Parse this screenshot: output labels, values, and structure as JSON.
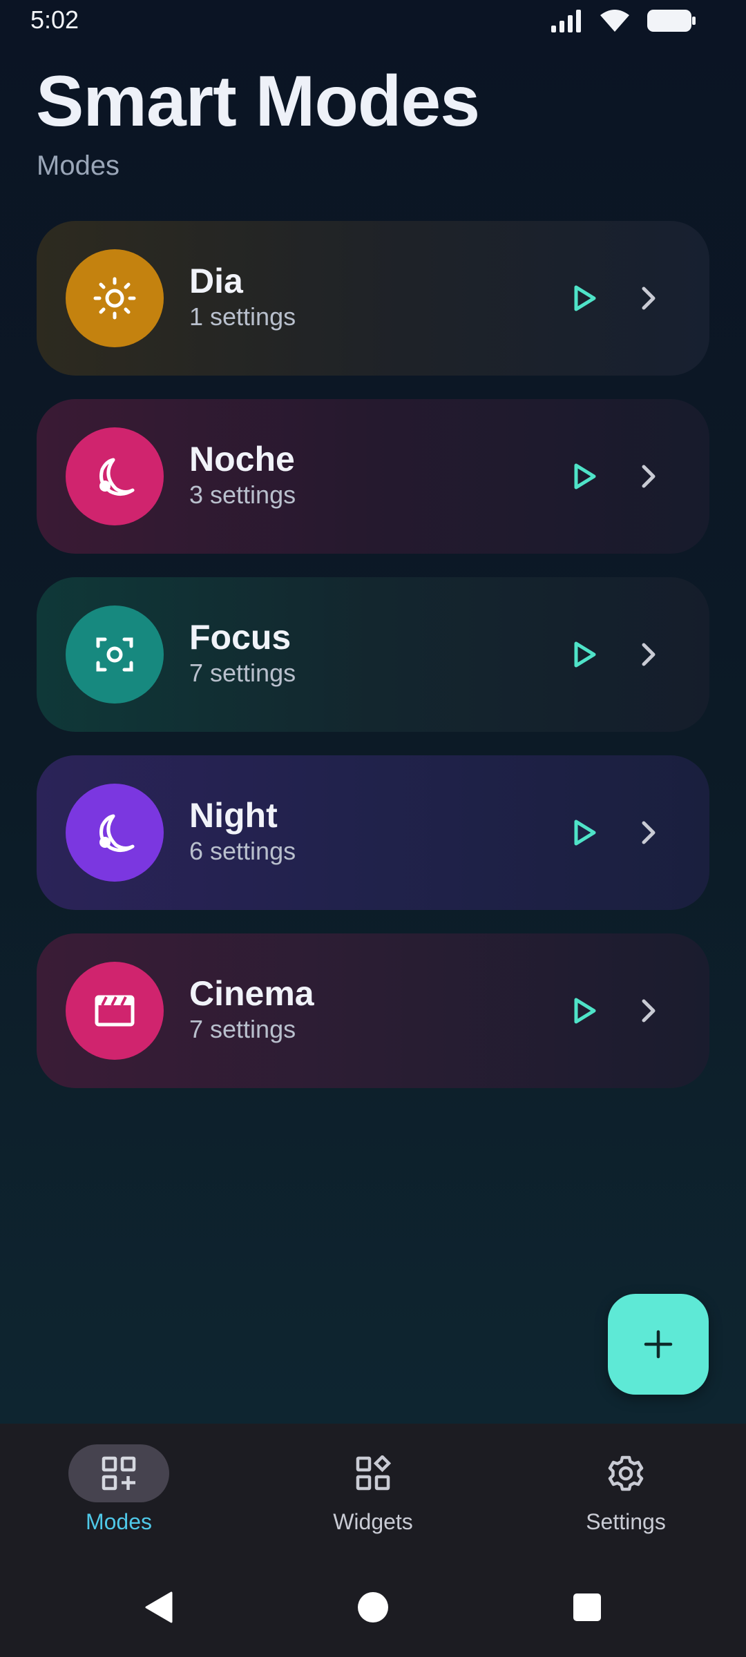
{
  "status_bar": {
    "time": "5:02"
  },
  "header": {
    "title": "Smart Modes",
    "subtitle": "Modes"
  },
  "modes": [
    {
      "name": "Dia",
      "count": "1 settings",
      "icon": "sun-icon",
      "color": "#c4820f"
    },
    {
      "name": "Noche",
      "count": "3 settings",
      "icon": "moon-icon",
      "color": "#d0246e"
    },
    {
      "name": "Focus",
      "count": "7 settings",
      "icon": "focus-icon",
      "color": "#17897f"
    },
    {
      "name": "Night",
      "count": "6 settings",
      "icon": "moon-icon",
      "color": "#7b37e0"
    },
    {
      "name": "Cinema",
      "count": "7 settings",
      "icon": "clapper-icon",
      "color": "#d0246e"
    }
  ],
  "fab": {
    "icon": "plus-icon",
    "color": "#5ee9d6"
  },
  "bottom_nav": {
    "items": [
      {
        "label": "Modes",
        "icon": "modes-grid-icon",
        "active": true
      },
      {
        "label": "Widgets",
        "icon": "widgets-icon",
        "active": false
      },
      {
        "label": "Settings",
        "icon": "gear-icon",
        "active": false
      }
    ],
    "active_color": "#4fc8e8"
  },
  "accent_colors": {
    "play": "#4fe3c8",
    "chevron": "#c9cbd4"
  }
}
